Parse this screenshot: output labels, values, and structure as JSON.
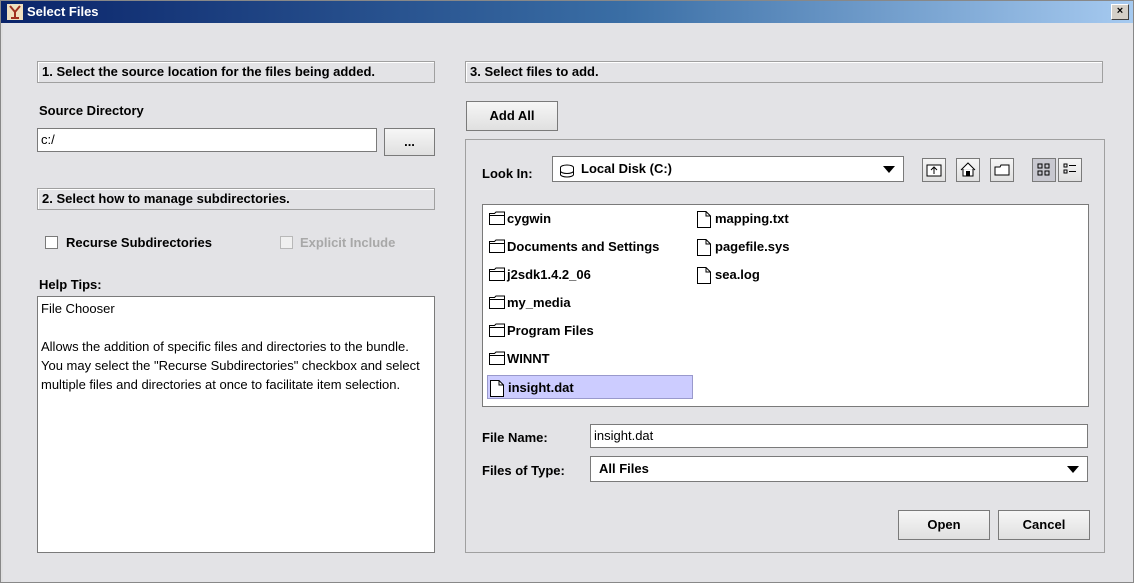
{
  "window": {
    "title": "Select Files",
    "close_label": "×"
  },
  "left": {
    "step1_header": "1.  Select the source location for the files being added.",
    "source_dir_label": "Source Directory",
    "source_dir_value": "c:/",
    "browse_label": "...",
    "step2_header": "2.  Select how to manage subdirectories.",
    "recurse_label": "Recurse Subdirectories",
    "explicit_label": "Explicit Include",
    "help_label": "Help Tips:",
    "help_text": "File Chooser\n\nAllows the addition of specific files and directories to the bundle.  You may select the \"Recurse Subdirectories\" checkbox and select multiple files and directories at once to facilitate item selection."
  },
  "right": {
    "step3_header": "3. Select files to add.",
    "add_all_label": "Add All",
    "look_in_label": "Look In:",
    "look_in_value": "Local Disk (C:)",
    "files": [
      {
        "name": "cygwin",
        "kind": "folder"
      },
      {
        "name": "Documents and Settings",
        "kind": "folder"
      },
      {
        "name": "j2sdk1.4.2_06",
        "kind": "folder"
      },
      {
        "name": "my_media",
        "kind": "folder"
      },
      {
        "name": "Program Files",
        "kind": "folder"
      },
      {
        "name": "WINNT",
        "kind": "folder"
      },
      {
        "name": "insight.dat",
        "kind": "file",
        "selected": true
      },
      {
        "name": "mapping.txt",
        "kind": "file"
      },
      {
        "name": "pagefile.sys",
        "kind": "file"
      },
      {
        "name": "sea.log",
        "kind": "file"
      }
    ],
    "file_name_label": "File Name:",
    "file_name_value": "insight.dat",
    "files_of_type_label": "Files of Type:",
    "files_of_type_value": "All Files",
    "open_label": "Open",
    "cancel_label": "Cancel"
  },
  "colors": {
    "selection": "#ccccff",
    "titlebar": "#0a246a"
  }
}
